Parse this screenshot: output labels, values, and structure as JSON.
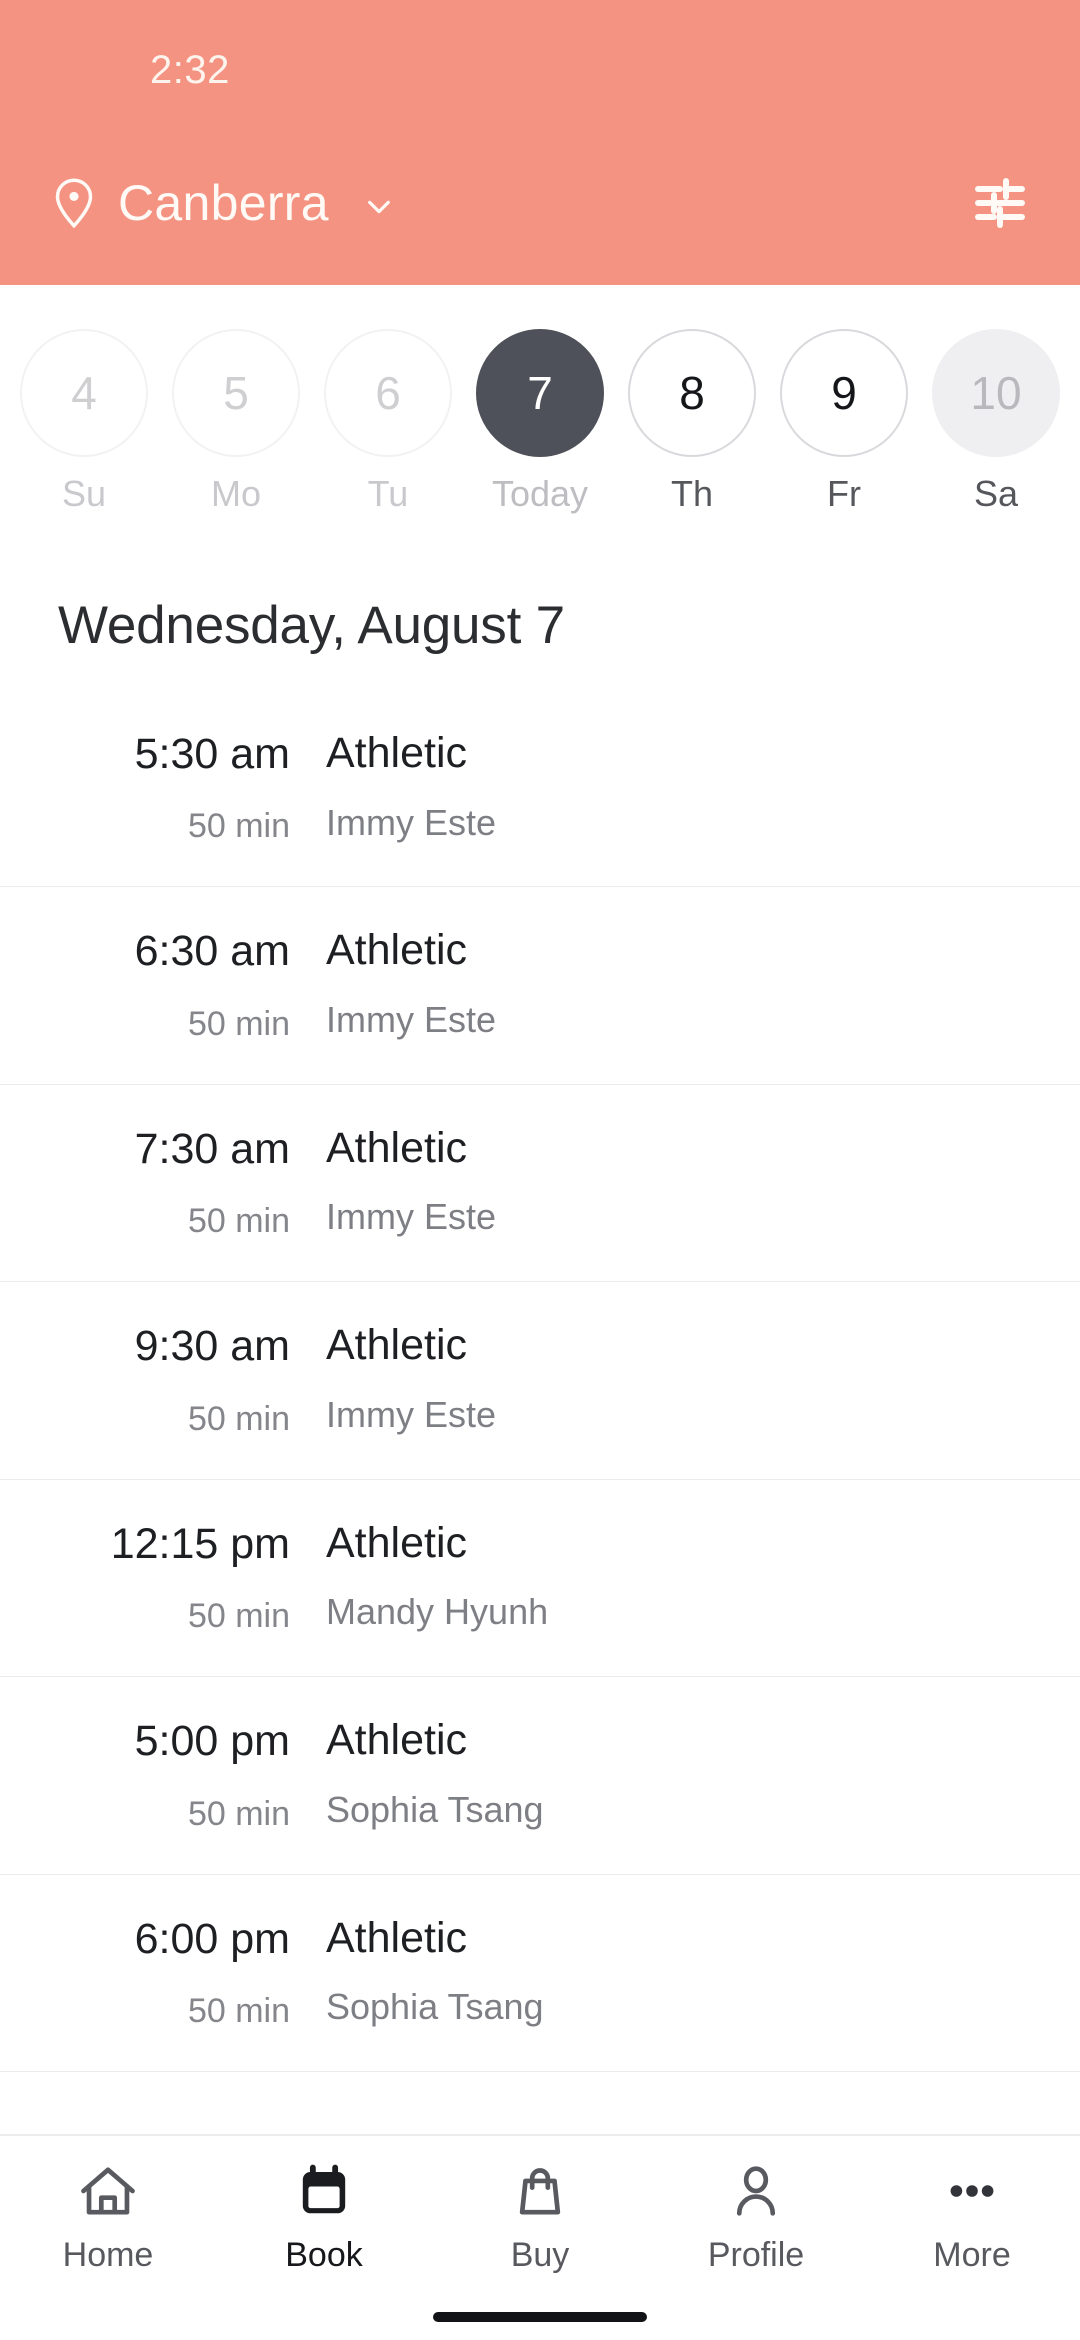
{
  "status_bar": {
    "time": "2:32"
  },
  "header": {
    "location_label": "Canberra",
    "pin_icon": "location-pin-icon",
    "chevron_icon": "chevron-down-icon",
    "filter_icon": "tune-filter-icon",
    "background_color": "#f59382"
  },
  "date_strip": {
    "days": [
      {
        "number": "4",
        "label": "Su",
        "state": "disabled"
      },
      {
        "number": "5",
        "label": "Mo",
        "state": "disabled"
      },
      {
        "number": "6",
        "label": "Tu",
        "state": "disabled"
      },
      {
        "number": "7",
        "label": "Today",
        "state": "selected"
      },
      {
        "number": "8",
        "label": "Th",
        "state": "normal"
      },
      {
        "number": "9",
        "label": "Fr",
        "state": "normal"
      },
      {
        "number": "10",
        "label": "Sa",
        "state": "muted"
      }
    ],
    "selected_color": "#4e5159"
  },
  "day_heading": "Wednesday, August 7",
  "classes": [
    {
      "time": "5:30 am",
      "duration": "50 min",
      "name": "Athletic",
      "instructor": "Immy Este"
    },
    {
      "time": "6:30 am",
      "duration": "50 min",
      "name": "Athletic",
      "instructor": "Immy Este"
    },
    {
      "time": "7:30 am",
      "duration": "50 min",
      "name": "Athletic",
      "instructor": "Immy Este"
    },
    {
      "time": "9:30 am",
      "duration": "50 min",
      "name": "Athletic",
      "instructor": "Immy Este"
    },
    {
      "time": "12:15 pm",
      "duration": "50 min",
      "name": "Athletic",
      "instructor": "Mandy Hyunh"
    },
    {
      "time": "5:00 pm",
      "duration": "50 min",
      "name": "Athletic",
      "instructor": "Sophia Tsang"
    },
    {
      "time": "6:00 pm",
      "duration": "50 min",
      "name": "Athletic",
      "instructor": "Sophia Tsang"
    }
  ],
  "bottom_nav": {
    "items": [
      {
        "label": "Home",
        "icon": "home-icon",
        "active": false
      },
      {
        "label": "Book",
        "icon": "calendar-icon",
        "active": true
      },
      {
        "label": "Buy",
        "icon": "shopping-bag-icon",
        "active": false
      },
      {
        "label": "Profile",
        "icon": "person-icon",
        "active": false
      },
      {
        "label": "More",
        "icon": "more-dots-icon",
        "active": false
      }
    ]
  }
}
